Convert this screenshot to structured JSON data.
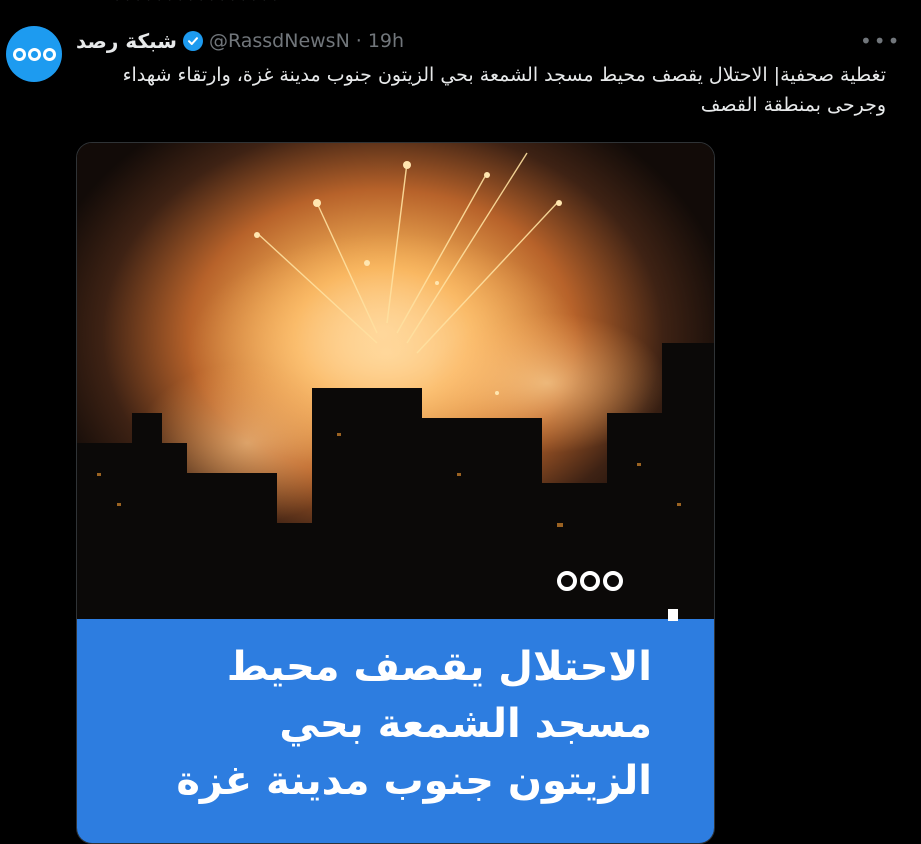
{
  "tweet": {
    "author_name": "شبكة رصد",
    "handle": "@RassdNewsN",
    "separator": "·",
    "time": "19h",
    "more_label": "•••",
    "text": "تغطية صحفية| الاحتلال يقصف محيط مسجد الشمعة بحي الزيتون جنوب مدينة غزة، وارتقاء شهداء وجرحى بمنطقة القصف"
  },
  "media": {
    "caption": "الاحتلال يقصف محيط مسجد الشمعة بحي الزيتون جنوب مدينة غزة"
  },
  "icons": {
    "avatar": "rassd-logo-icon",
    "verified": "verified-badge-icon",
    "more": "more-options-icon"
  },
  "colors": {
    "background": "#000000",
    "text_primary": "#e7e9ea",
    "text_secondary": "#71767b",
    "accent_blue": "#1d9bf0",
    "caption_banner": "#2d7de0"
  }
}
